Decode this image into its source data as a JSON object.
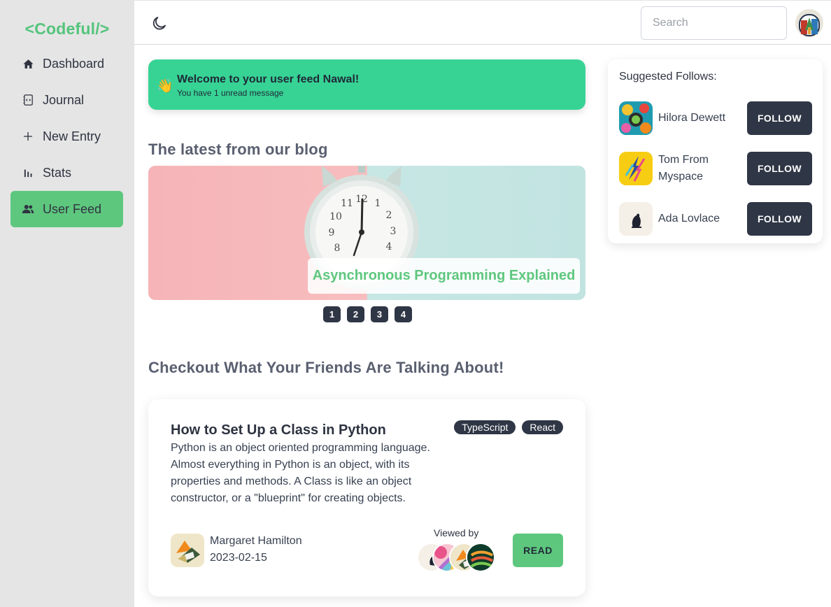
{
  "app": {
    "logo": "<Codeful/>"
  },
  "sidebar": {
    "items": [
      {
        "label": "Dashboard",
        "icon": "home-icon",
        "active": false
      },
      {
        "label": "Journal",
        "icon": "journal-icon",
        "active": false
      },
      {
        "label": "New Entry",
        "icon": "plus-icon",
        "active": false
      },
      {
        "label": "Stats",
        "icon": "bar-chart-icon",
        "active": false
      },
      {
        "label": "User Feed",
        "icon": "users-icon",
        "active": true
      }
    ]
  },
  "topbar": {
    "theme_toggle_icon": "moon-icon",
    "search_placeholder": "Search",
    "search_value": ""
  },
  "welcome": {
    "emoji": "👋",
    "title": "Welcome to your user feed Nawal!",
    "subtitle": "You have 1 unread message"
  },
  "blog": {
    "heading": "The latest from our blog",
    "caption": "Asynchronous Programming Explained",
    "pages": [
      "1",
      "2",
      "3",
      "4"
    ]
  },
  "friends": {
    "heading": "Checkout What Your Friends Are Talking About!",
    "post": {
      "title": "How to Set Up a Class in Python",
      "body": "Python is an object oriented programming language. Almost everything in Python is an object, with its properties and methods. A Class is like an object constructor, or a \"blueprint\" for creating objects.",
      "tags": [
        "TypeScript",
        "React"
      ],
      "author": "Margaret Hamilton",
      "date": "2023-02-15",
      "viewed_by_label": "Viewed by",
      "read_label": "READ"
    }
  },
  "suggested": {
    "title": "Suggested Follows:",
    "users": [
      {
        "name": "Hilora Dewett",
        "button": "FOLLOW"
      },
      {
        "name": "Tom From Myspace",
        "button": "FOLLOW"
      },
      {
        "name": "Ada Lovlace",
        "button": "FOLLOW"
      }
    ]
  },
  "colors": {
    "accent_green": "#5ec77e",
    "banner_green": "#37d395",
    "dark_button": "#2f3645",
    "sidebar_bg": "#e5e5e5"
  }
}
